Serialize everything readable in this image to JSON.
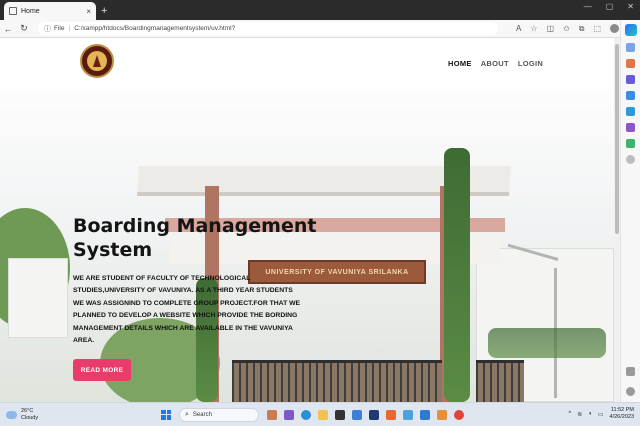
{
  "browser": {
    "tab_title": "Home",
    "tab_close": "×",
    "new_tab": "+",
    "url_label": "File",
    "url": "C:/xampp/htdocs/Boardingmanagementsystem/uv.html?",
    "controls": {
      "minimize": "—",
      "maximize": "▢",
      "close": "✕"
    }
  },
  "site": {
    "nav": [
      {
        "label": "HOME",
        "active": true
      },
      {
        "label": "ABOUT",
        "active": false
      },
      {
        "label": "LOGIN",
        "active": false
      }
    ],
    "hero": {
      "title_line1": "Boarding Management",
      "title_line2": "System",
      "description": "WE ARE STUDENT OF FACULTY OF TECHNOLOGICAL STUDIES,UNIVERSITY OF VAVUNIYA. AS A THIRD YEAR STUDENTS WE WAS ASSIGNIND TO COMPLETE GROUP PROJECT.FOR THAT WE PLANNED TO DEVELOP A WEBSITE WHICH PROVIDE THE BORDING MANAGEMENT DETAILS WHICH ARE AVAILABLE IN THE VAVUNIYA AREA.",
      "button": "READ MORE",
      "signboard": "UNIVERSITY OF VAVUNIYA SRILANKA"
    },
    "colors": {
      "button": "#ea3c6a",
      "logo_bg": "#5b1a10",
      "logo_gold": "#e2b654"
    }
  },
  "taskbar": {
    "weather_temp": "26°C",
    "weather_desc": "Cloudy",
    "search_placeholder": "Search",
    "time": "11:52 PM",
    "date": "4/26/2023"
  }
}
